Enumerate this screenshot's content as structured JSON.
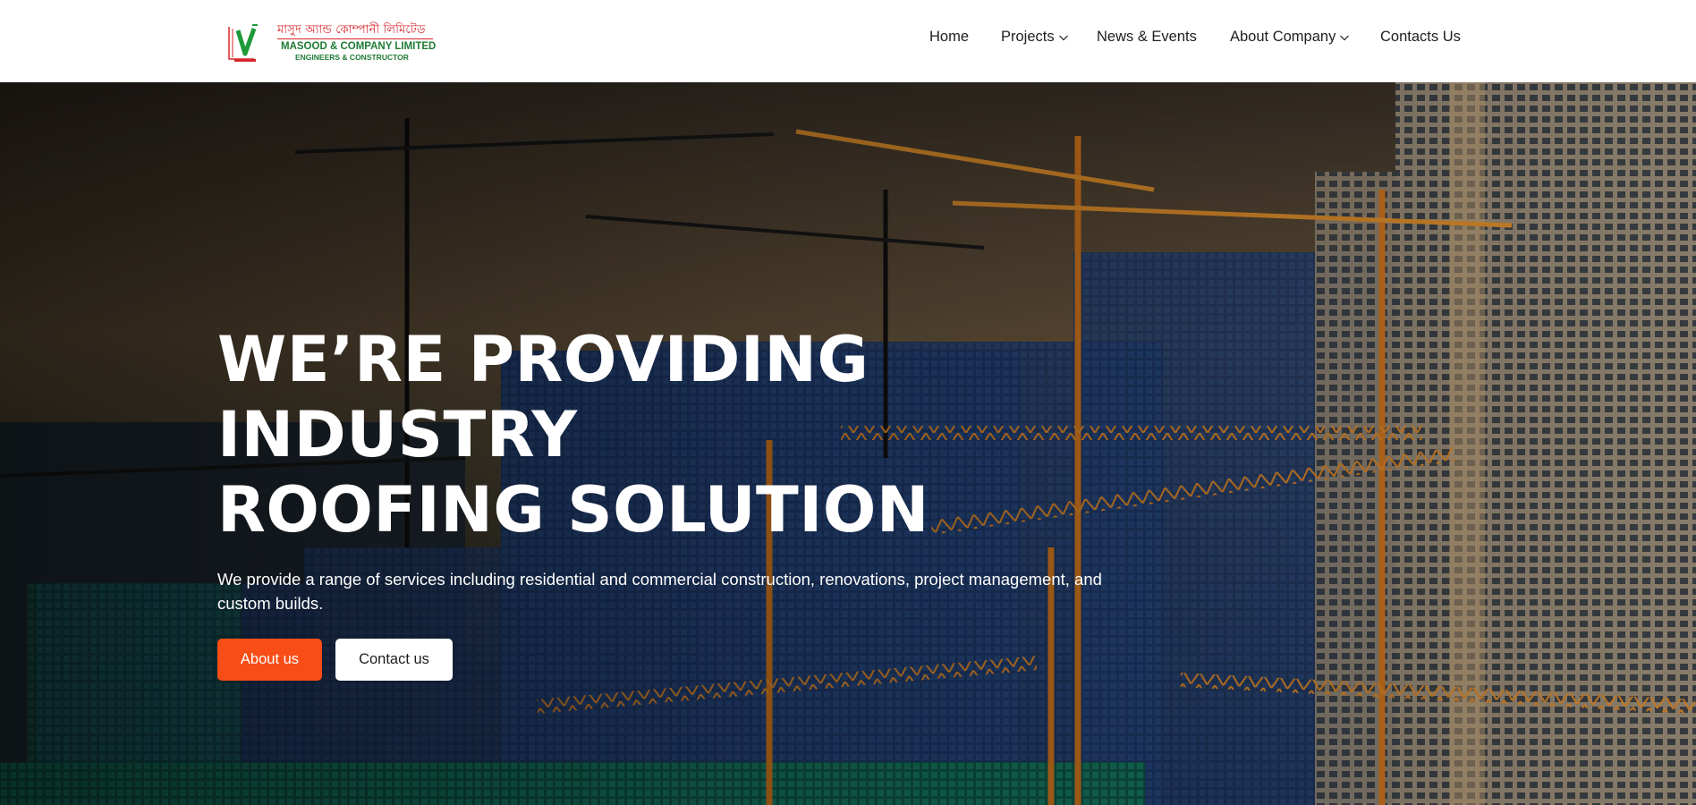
{
  "brand": {
    "name_bengali": "মাসুদ অ্যান্ড কোম্পানী লিমিটেড",
    "name_english": "MASOOD & COMPANY LIMITED",
    "tagline": "ENGINEERS & CONSTRUCTOR",
    "logo_icon": "lv-logo-icon"
  },
  "nav": {
    "items": [
      {
        "label": "Home",
        "has_dropdown": false
      },
      {
        "label": "Projects",
        "has_dropdown": true
      },
      {
        "label": "News & Events",
        "has_dropdown": false
      },
      {
        "label": "About Company",
        "has_dropdown": true
      },
      {
        "label": "Contacts Us",
        "has_dropdown": false
      }
    ],
    "dropdown_icon": "chevron-down-icon"
  },
  "hero": {
    "title_line1": "WE’RE PROVIDING INDUSTRY",
    "title_line2": "ROOFING SOLUTION",
    "description": "We provide a range of services including residential and commercial construction, renovations, project management, and custom builds.",
    "primary_button": "About us",
    "secondary_button": "Contact us",
    "background_image": "construction-site-cranes-photo"
  },
  "colors": {
    "accent": "#f84d16",
    "brand_red": "#d7262b",
    "brand_green": "#1f7a34",
    "nav_text": "#1e1e1e",
    "crane_orange": "#d4781f"
  }
}
